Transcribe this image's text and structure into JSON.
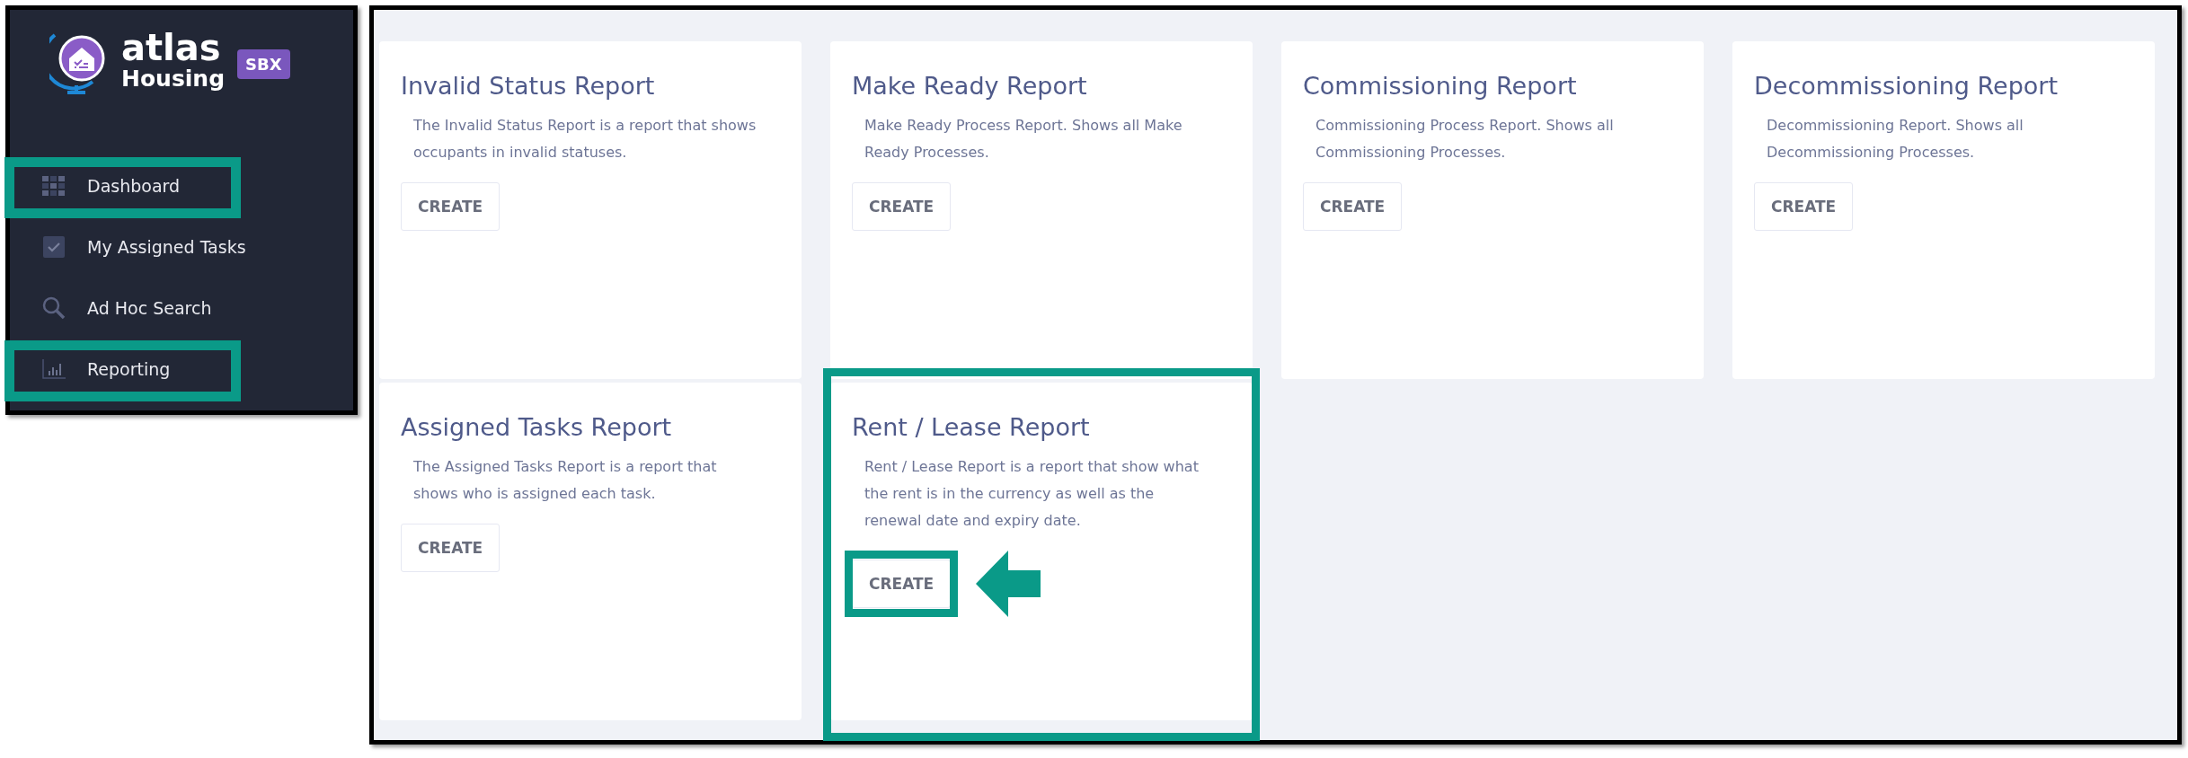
{
  "sidebar": {
    "logo": {
      "name": "atlas",
      "subtitle": "Housing",
      "badge": "SBX"
    },
    "items": [
      {
        "label": "Dashboard",
        "kind": "grid",
        "highlighted": true
      },
      {
        "label": "My Assigned Tasks",
        "kind": "check",
        "highlighted": false
      },
      {
        "label": "Ad Hoc Search",
        "kind": "search",
        "highlighted": false
      },
      {
        "label": "Reporting",
        "kind": "chart",
        "highlighted": true
      }
    ]
  },
  "reports": [
    {
      "title": "Invalid Status Report",
      "description": "The Invalid Status Report is a report that shows occupants in invalid statuses.",
      "button": "CREATE",
      "highlighted": false,
      "button_highlighted": false
    },
    {
      "title": "Make Ready Report",
      "description": "Make Ready Process Report. Shows all Make Ready Processes.",
      "button": "CREATE",
      "highlighted": false,
      "button_highlighted": false
    },
    {
      "title": "Commissioning Report",
      "description": "Commissioning Process Report. Shows all Commissioning Processes.",
      "button": "CREATE",
      "highlighted": false,
      "button_highlighted": false
    },
    {
      "title": "Decommissioning Report",
      "description": "Decommissioning Report. Shows all Decommissioning Processes.",
      "button": "CREATE",
      "highlighted": false,
      "button_highlighted": false
    },
    {
      "title": "Assigned Tasks Report",
      "description": "The Assigned Tasks Report is a report that shows who is assigned each task.",
      "button": "CREATE",
      "highlighted": false,
      "button_highlighted": false
    },
    {
      "title": "Rent / Lease Report",
      "description": "Rent / Lease Report is a report that show what the rent is in the currency as well as the renewal date and expiry date.",
      "button": "CREATE",
      "highlighted": true,
      "button_highlighted": true
    }
  ]
}
